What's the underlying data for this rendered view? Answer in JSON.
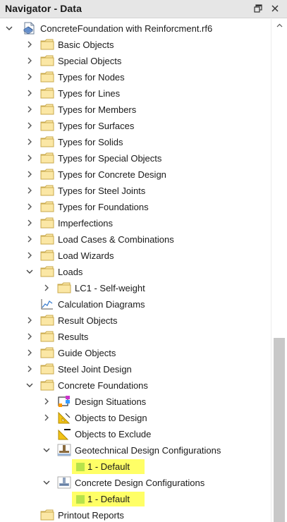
{
  "panel": {
    "title": "Navigator - Data"
  },
  "title_buttons": {
    "float_icon": "float-window-icon",
    "close_icon": "close-icon"
  },
  "tree": {
    "root": "ConcreteFoundation with Reinforcment.rf6",
    "items": [
      {
        "label": "Basic Objects",
        "state": "collapsed",
        "icon": "folder-icon"
      },
      {
        "label": "Special Objects",
        "state": "collapsed",
        "icon": "folder-icon"
      },
      {
        "label": "Types for Nodes",
        "state": "collapsed",
        "icon": "folder-icon"
      },
      {
        "label": "Types for Lines",
        "state": "collapsed",
        "icon": "folder-icon"
      },
      {
        "label": "Types for Members",
        "state": "collapsed",
        "icon": "folder-icon"
      },
      {
        "label": "Types for Surfaces",
        "state": "collapsed",
        "icon": "folder-icon"
      },
      {
        "label": "Types for Solids",
        "state": "collapsed",
        "icon": "folder-icon"
      },
      {
        "label": "Types for Special Objects",
        "state": "collapsed",
        "icon": "folder-icon"
      },
      {
        "label": "Types for Concrete Design",
        "state": "collapsed",
        "icon": "folder-icon"
      },
      {
        "label": "Types for Steel Joints",
        "state": "collapsed",
        "icon": "folder-icon"
      },
      {
        "label": "Types for Foundations",
        "state": "collapsed",
        "icon": "folder-icon"
      },
      {
        "label": "Imperfections",
        "state": "collapsed",
        "icon": "folder-icon"
      },
      {
        "label": "Load Cases & Combinations",
        "state": "collapsed",
        "icon": "folder-icon"
      },
      {
        "label": "Load Wizards",
        "state": "collapsed",
        "icon": "folder-icon"
      },
      {
        "label": "Loads",
        "state": "expanded",
        "icon": "folder-icon"
      },
      {
        "label": "LC1 - Self-weight",
        "state": "collapsed",
        "icon": "folder-icon"
      },
      {
        "label": "Calculation Diagrams",
        "state": "leaf",
        "icon": "diagram-icon"
      },
      {
        "label": "Result Objects",
        "state": "collapsed",
        "icon": "folder-icon"
      },
      {
        "label": "Results",
        "state": "collapsed",
        "icon": "folder-icon"
      },
      {
        "label": "Guide Objects",
        "state": "collapsed",
        "icon": "folder-icon"
      },
      {
        "label": "Steel Joint Design",
        "state": "collapsed",
        "icon": "folder-icon"
      },
      {
        "label": "Concrete Foundations",
        "state": "expanded",
        "icon": "folder-icon"
      },
      {
        "label": "Design Situations",
        "state": "collapsed",
        "icon": "design-situations-icon"
      },
      {
        "label": "Objects to Design",
        "state": "collapsed",
        "icon": "objects-to-design-icon"
      },
      {
        "label": "Objects to Exclude",
        "state": "leaf",
        "icon": "objects-to-exclude-icon"
      },
      {
        "label": "Geotechnical Design Configurations",
        "state": "expanded",
        "icon": "geotechnical-config-icon"
      },
      {
        "label": "1 - Default",
        "state": "leaf",
        "icon": "config-item-icon",
        "highlighted": true
      },
      {
        "label": "Concrete Design Configurations",
        "state": "expanded",
        "icon": "concrete-config-icon"
      },
      {
        "label": "1 - Default",
        "state": "leaf",
        "icon": "config-item-icon",
        "highlighted": true
      },
      {
        "label": "Printout Reports",
        "state": "leaf",
        "icon": "folder-icon"
      }
    ]
  },
  "colors": {
    "highlight": "#ffff66",
    "folder_fill": "#fbe7a5",
    "folder_stroke": "#c9a94c",
    "titlebar": "#e6e6e6"
  }
}
